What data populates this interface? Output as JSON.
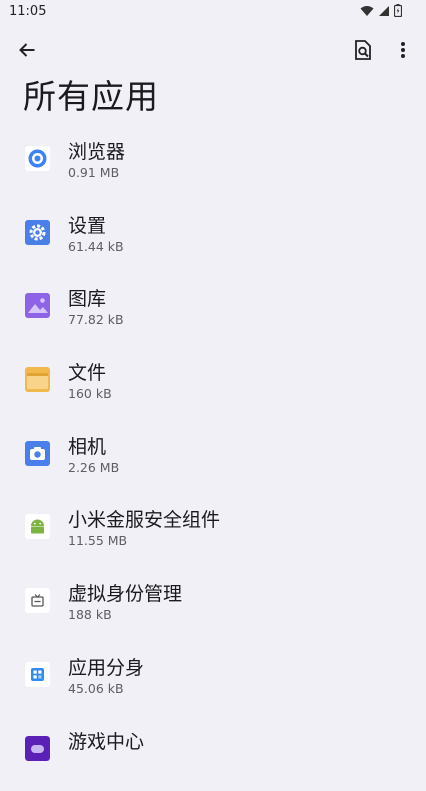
{
  "status": {
    "time": "11:05"
  },
  "page": {
    "title": "所有应用"
  },
  "apps": [
    {
      "name": "浏览器",
      "size": "0.91 MB",
      "icon": "browser-icon"
    },
    {
      "name": "设置",
      "size": "61.44 kB",
      "icon": "settings-gear-icon"
    },
    {
      "name": "图库",
      "size": "77.82 kB",
      "icon": "gallery-icon"
    },
    {
      "name": "文件",
      "size": "160 kB",
      "icon": "folder-icon"
    },
    {
      "name": "相机",
      "size": "2.26 MB",
      "icon": "camera-icon"
    },
    {
      "name": "小米金服安全组件",
      "size": "11.55 MB",
      "icon": "android-icon"
    },
    {
      "name": "虚拟身份管理",
      "size": "188 kB",
      "icon": "tv-icon"
    },
    {
      "name": "应用分身",
      "size": "45.06 kB",
      "icon": "app-clone-icon"
    },
    {
      "name": "游戏中心",
      "size": "",
      "icon": "game-center-icon"
    }
  ],
  "colors": {
    "background": "#f1f0f6",
    "browser": "#3b82f6",
    "settings": "#4a7ee8",
    "gallery": "#8f63e6",
    "folder": "#f0b94b",
    "camera": "#4a7ee8",
    "android": "#7cb342",
    "clone": "#2f8cf0",
    "game": "#5b21b6"
  }
}
